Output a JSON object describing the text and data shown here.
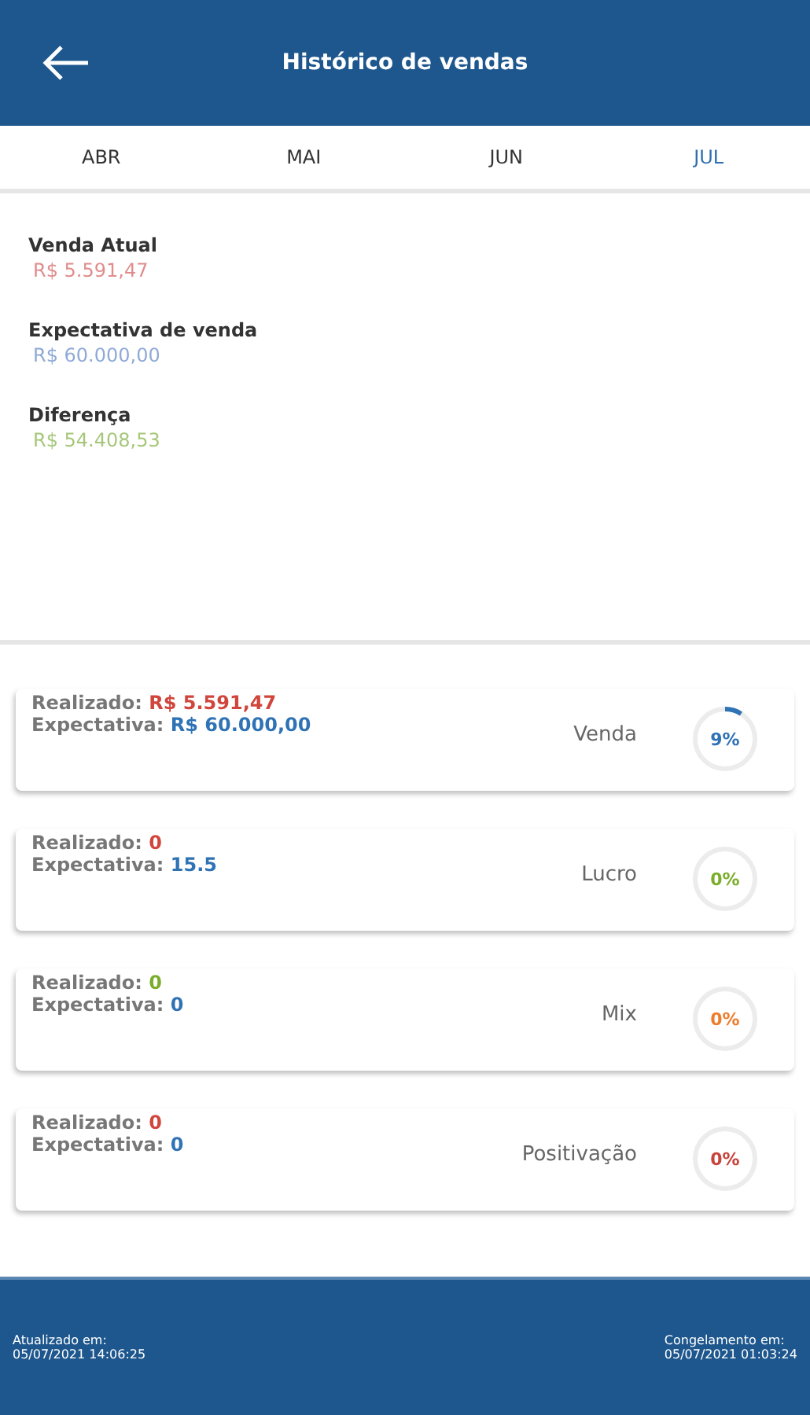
{
  "header": {
    "title": "Histórico de vendas"
  },
  "tabs": [
    {
      "label": "ABR",
      "selected": false
    },
    {
      "label": "MAI",
      "selected": false
    },
    {
      "label": "JUN",
      "selected": false
    },
    {
      "label": "JUL",
      "selected": true
    }
  ],
  "summary": [
    {
      "label": "Venda Atual",
      "value": "R$ 5.591,47",
      "color": "#e08c8c"
    },
    {
      "label": "Expectativa de venda",
      "value": "R$ 60.000,00",
      "color": "#8fa9d6"
    },
    {
      "label": "Diferença",
      "value": "R$ 54.408,53",
      "color": "#a6c77a"
    }
  ],
  "cards": [
    {
      "realized": {
        "label": "Realizado:",
        "value": "R$ 5.591,47",
        "color": "#d0453c"
      },
      "expected": {
        "label": "Expectativa:",
        "value": "R$ 60.000,00"
      },
      "name": "Venda",
      "percent": {
        "text": "9%",
        "color": "#2f73b5",
        "level": 0.09
      }
    },
    {
      "realized": {
        "label": "Realizado:",
        "value": "0",
        "color": "#d0453c"
      },
      "expected": {
        "label": "Expectativa:",
        "value": "15.5"
      },
      "name": "Lucro",
      "percent": {
        "text": "0%",
        "color": "#7aae2a"
      }
    },
    {
      "realized": {
        "label": "Realizado:",
        "value": "0",
        "color": "#7aae2a"
      },
      "expected": {
        "label": "Expectativa:",
        "value": "0"
      },
      "name": "Mix",
      "percent": {
        "text": "0%",
        "color": "#ee7d2b"
      }
    },
    {
      "realized": {
        "label": "Realizado:",
        "value": "0",
        "color": "#d0453c"
      },
      "expected": {
        "label": "Expectativa:",
        "value": "0"
      },
      "name": "Positivação",
      "percent": {
        "text": "0%",
        "color": "#c8433b"
      }
    }
  ],
  "footer": {
    "updated": {
      "label": "Atualizado em:",
      "value": "05/07/2021 14:06:25"
    },
    "frozen": {
      "label": "Congelamento em:",
      "value": "05/07/2021 01:03:24"
    }
  }
}
